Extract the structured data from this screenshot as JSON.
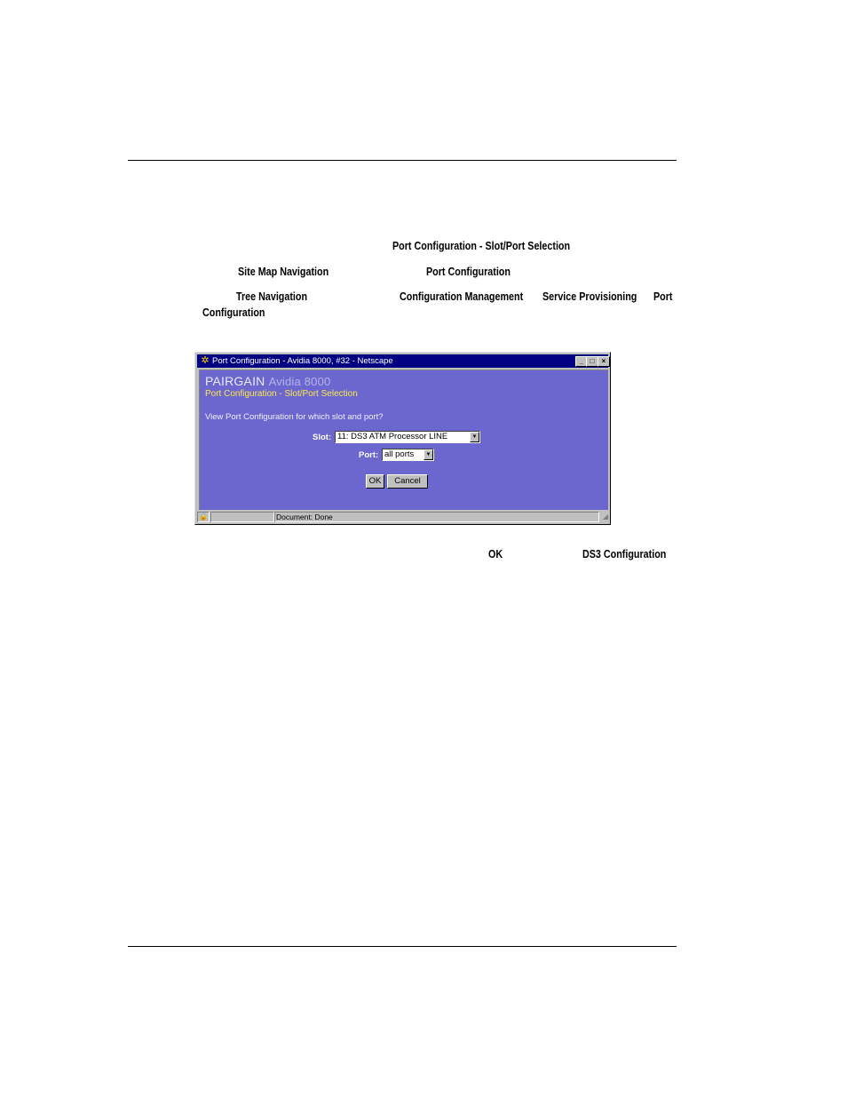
{
  "doc": {
    "line1": "Port Configuration - Slot/Port Selection",
    "line2a": "Site Map Navigation",
    "line2b": "Port Configuration",
    "line3a": "Tree Navigation",
    "line3b": "Configuration Management",
    "line3c": "Service Provisioning",
    "line3d": "Port",
    "line4": "Configuration",
    "after_ok": "OK",
    "after_ds3": "DS3 Configuration"
  },
  "window": {
    "title": "Port Configuration - Avidia 8000, #32 - Netscape",
    "brand": "PAIRGAIN",
    "brand_sub": "Avidia 8000",
    "page_title": "Port Configuration - Slot/Port Selection",
    "question": "View Port Configuration for which slot and port?",
    "slot_label": "Slot:",
    "slot_value": "11: DS3 ATM Processor LINE",
    "port_label": "Port:",
    "port_value": "all ports",
    "ok_label": "OK",
    "cancel_label": "Cancel",
    "status": "Document: Done"
  }
}
